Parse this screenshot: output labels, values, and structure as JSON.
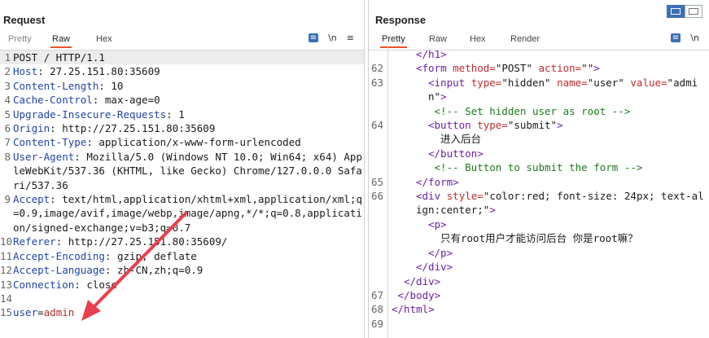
{
  "request": {
    "title": "Request",
    "tabs": [
      "Pretty",
      "Raw",
      "Hex"
    ],
    "active_tab": "Raw",
    "icons": {
      "pretty_print": "wrap-lines-icon",
      "newline": "\\n",
      "menu": "≡"
    },
    "lines": [
      {
        "n": "1",
        "segs": [
          {
            "c": "",
            "t": "POST / HTTP/1.1"
          }
        ]
      },
      {
        "n": "2",
        "segs": [
          {
            "c": "k",
            "t": "Host"
          },
          {
            "c": "",
            "t": ": 27.25.151.80:35609"
          }
        ]
      },
      {
        "n": "3",
        "segs": [
          {
            "c": "k",
            "t": "Content-Length"
          },
          {
            "c": "",
            "t": ": 10"
          }
        ]
      },
      {
        "n": "4",
        "segs": [
          {
            "c": "k",
            "t": "Cache-Control"
          },
          {
            "c": "",
            "t": ": max-age=0"
          }
        ]
      },
      {
        "n": "5",
        "segs": [
          {
            "c": "k",
            "t": "Upgrade-Insecure-Requests"
          },
          {
            "c": "",
            "t": ": 1"
          }
        ]
      },
      {
        "n": "6",
        "segs": [
          {
            "c": "k",
            "t": "Origin"
          },
          {
            "c": "",
            "t": ": http://27.25.151.80:35609"
          }
        ]
      },
      {
        "n": "7",
        "segs": [
          {
            "c": "k",
            "t": "Content-Type"
          },
          {
            "c": "",
            "t": ": application/x-www-form-urlencoded"
          }
        ]
      },
      {
        "n": "8",
        "segs": [
          {
            "c": "k",
            "t": "User-Agent"
          },
          {
            "c": "",
            "t": ": Mozilla/5.0 (Windows NT 10.0; Win64; x64) AppleWebKit/537.36 (KHTML, like Gecko) Chrome/127.0.0.0 Safari/537.36"
          }
        ]
      },
      {
        "n": "9",
        "segs": [
          {
            "c": "k",
            "t": "Accept"
          },
          {
            "c": "",
            "t": ": text/html,application/xhtml+xml,application/xml;q=0.9,image/avif,image/webp,image/apng,*/*;q=0.8,application/signed-exchange;v=b3;q=0.7"
          }
        ]
      },
      {
        "n": "10",
        "segs": [
          {
            "c": "k",
            "t": "Referer"
          },
          {
            "c": "",
            "t": ": http://27.25.151.80:35609/"
          }
        ]
      },
      {
        "n": "11",
        "segs": [
          {
            "c": "k",
            "t": "Accept-Encoding"
          },
          {
            "c": "",
            "t": ": gzip, deflate"
          }
        ]
      },
      {
        "n": "12",
        "segs": [
          {
            "c": "k",
            "t": "Accept-Language"
          },
          {
            "c": "",
            "t": ": zh-CN,zh;q=0.9"
          }
        ]
      },
      {
        "n": "13",
        "segs": [
          {
            "c": "k",
            "t": "Connection"
          },
          {
            "c": "",
            "t": ": close"
          }
        ]
      },
      {
        "n": "14",
        "segs": [
          {
            "c": "",
            "t": ""
          }
        ]
      },
      {
        "n": "15",
        "segs": [
          {
            "c": "k",
            "t": "user"
          },
          {
            "c": "",
            "t": "="
          },
          {
            "c": "v",
            "t": "admin"
          }
        ]
      }
    ]
  },
  "response": {
    "title": "Response",
    "tabs": [
      "Pretty",
      "Raw",
      "Hex",
      "Render"
    ],
    "active_tab": "Pretty",
    "icons": {
      "pretty_print": "wrap-lines-icon",
      "newline": "\\n"
    },
    "lines": [
      {
        "n": "",
        "indent": 4,
        "segs": [
          {
            "c": "t",
            "t": "</h1>"
          }
        ]
      },
      {
        "n": "62",
        "indent": 4,
        "segs": [
          {
            "c": "t",
            "t": "<form "
          },
          {
            "c": "a",
            "t": "method="
          },
          {
            "c": "",
            "t": "\"POST\" "
          },
          {
            "c": "a",
            "t": "action="
          },
          {
            "c": "",
            "t": "\"\""
          },
          {
            "c": "t",
            "t": ">"
          }
        ]
      },
      {
        "n": "63",
        "indent": 6,
        "segs": [
          {
            "c": "t",
            "t": "<input "
          },
          {
            "c": "a",
            "t": "type="
          },
          {
            "c": "",
            "t": "\"hidden\" "
          },
          {
            "c": "a",
            "t": "name="
          },
          {
            "c": "",
            "t": "\"user\" "
          },
          {
            "c": "a",
            "t": "value="
          },
          {
            "c": "",
            "t": "\"admin\""
          },
          {
            "c": "t",
            "t": ">"
          }
        ]
      },
      {
        "n": "",
        "indent": 6,
        "segs": [
          {
            "c": "c",
            "t": " <!-- Set hidden user as root -->"
          }
        ]
      },
      {
        "n": "64",
        "indent": 6,
        "segs": [
          {
            "c": "t",
            "t": "<button "
          },
          {
            "c": "a",
            "t": "type="
          },
          {
            "c": "",
            "t": "\"submit\""
          },
          {
            "c": "t",
            "t": ">"
          }
        ]
      },
      {
        "n": "",
        "indent": 8,
        "segs": [
          {
            "c": "",
            "t": "进入后台"
          }
        ]
      },
      {
        "n": "",
        "indent": 6,
        "segs": [
          {
            "c": "t",
            "t": "</button>"
          }
        ]
      },
      {
        "n": "",
        "indent": 6,
        "segs": [
          {
            "c": "c",
            "t": " <!-- Button to submit the form -->"
          }
        ]
      },
      {
        "n": "65",
        "indent": 4,
        "segs": [
          {
            "c": "t",
            "t": "</form>"
          }
        ]
      },
      {
        "n": "66",
        "indent": 4,
        "segs": [
          {
            "c": "t",
            "t": "<div "
          },
          {
            "c": "a",
            "t": "style="
          },
          {
            "c": "",
            "t": "\"color:red; font-size: 24px; text-align:center;\""
          },
          {
            "c": "t",
            "t": ">"
          }
        ]
      },
      {
        "n": "",
        "indent": 6,
        "segs": [
          {
            "c": "t",
            "t": "<p>"
          }
        ]
      },
      {
        "n": "",
        "indent": 8,
        "segs": [
          {
            "c": "",
            "t": "只有root用户才能访问后台 你是root嘛？"
          }
        ]
      },
      {
        "n": "",
        "indent": 6,
        "segs": [
          {
            "c": "t",
            "t": "</p>"
          }
        ]
      },
      {
        "n": "",
        "indent": 4,
        "segs": [
          {
            "c": "t",
            "t": "</div>"
          }
        ]
      },
      {
        "n": "",
        "indent": 0,
        "segs": [
          {
            "c": "",
            "t": ""
          }
        ]
      },
      {
        "n": "",
        "indent": 2,
        "segs": [
          {
            "c": "t",
            "t": "</div>"
          }
        ]
      },
      {
        "n": "67",
        "indent": 1,
        "segs": [
          {
            "c": "t",
            "t": "</body>"
          }
        ]
      },
      {
        "n": "68",
        "indent": 0,
        "segs": [
          {
            "c": "t",
            "t": "</html>"
          }
        ]
      },
      {
        "n": "69",
        "indent": 0,
        "segs": [
          {
            "c": "",
            "t": ""
          }
        ]
      }
    ]
  },
  "colors": {
    "accent": "#e8552a",
    "header_key": "#2144a8",
    "tag": "#6b1fa6",
    "attr": "#bf2b2b",
    "comment": "#1f7a1f",
    "arrow": "#e8404a"
  }
}
